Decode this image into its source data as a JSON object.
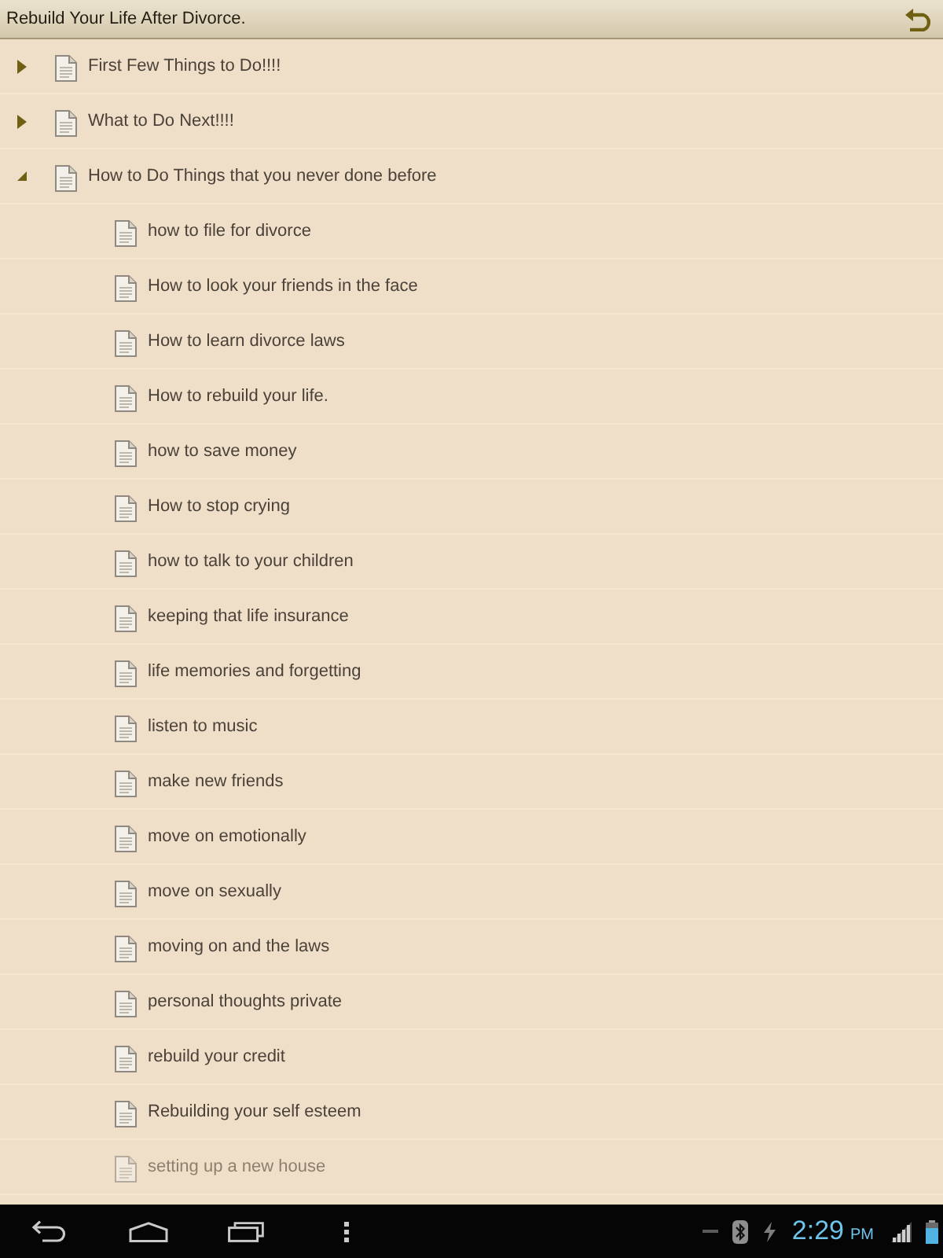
{
  "window": {
    "title": "Rebuild Your Life After Divorce."
  },
  "tree": [
    {
      "label": "First Few Things to Do!!!!",
      "expanded": false
    },
    {
      "label": "What to Do Next!!!!",
      "expanded": false
    },
    {
      "label": "How to Do Things that you never done before",
      "expanded": true,
      "children": [
        {
          "label": "how to file for divorce"
        },
        {
          "label": "How to look your friends in the face"
        },
        {
          "label": "How to learn divorce laws"
        },
        {
          "label": "How to rebuild your life."
        },
        {
          "label": "how to save money"
        },
        {
          "label": "How to stop crying"
        },
        {
          "label": "how to talk to your children"
        },
        {
          "label": "keeping that life insurance"
        },
        {
          "label": "life memories and forgetting"
        },
        {
          "label": "listen to music"
        },
        {
          "label": "make new friends"
        },
        {
          "label": "move on emotionally"
        },
        {
          "label": "move on sexually"
        },
        {
          "label": "moving on and the laws"
        },
        {
          "label": "personal thoughts private"
        },
        {
          "label": "rebuild your credit"
        },
        {
          "label": "Rebuilding your self esteem"
        },
        {
          "label": "setting up a new house"
        }
      ]
    }
  ],
  "nav_bar": {
    "time": "2:29",
    "meridiem": "PM"
  }
}
